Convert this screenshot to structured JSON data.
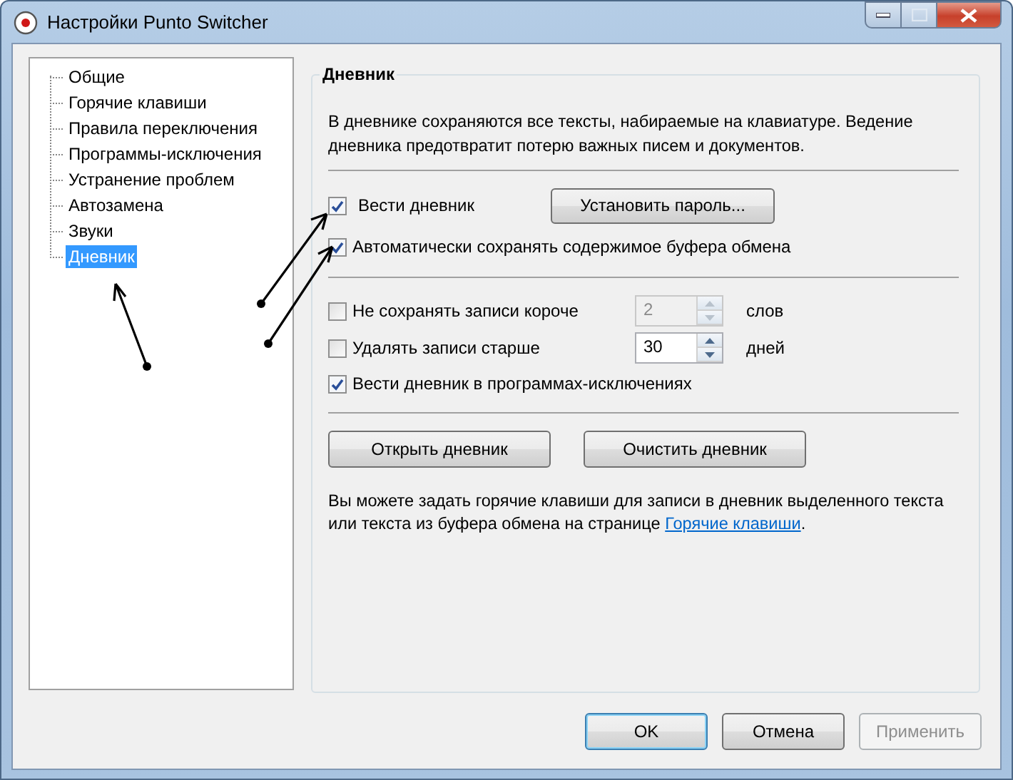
{
  "window": {
    "title": "Настройки Punto Switcher"
  },
  "sidebar": {
    "items": [
      {
        "label": "Общие",
        "selected": false
      },
      {
        "label": "Горячие клавиши",
        "selected": false
      },
      {
        "label": "Правила переключения",
        "selected": false
      },
      {
        "label": "Программы-исключения",
        "selected": false
      },
      {
        "label": "Устранение проблем",
        "selected": false
      },
      {
        "label": "Автозамена",
        "selected": false
      },
      {
        "label": "Звуки",
        "selected": false
      },
      {
        "label": "Дневник",
        "selected": true
      }
    ]
  },
  "group": {
    "title": "Дневник",
    "description": "В дневнике сохраняются все тексты, набираемые на клавиатуре. Ведение дневника предотвратит потерю важных писем и документов.",
    "sections": [
      [
        {
          "kind": "checkbox",
          "label": "Вести дневник",
          "checked": true,
          "button": "Установить пароль..."
        },
        {
          "kind": "checkbox",
          "label": "Автоматически сохранять содержимое буфера обмена",
          "checked": true
        }
      ],
      [
        {
          "kind": "spin",
          "label": "Не сохранять записи короче",
          "checked": false,
          "value": "2",
          "unit": "слов",
          "disabled": true
        },
        {
          "kind": "spin",
          "label": "Удалять записи старше",
          "checked": false,
          "value": "30",
          "unit": "дней",
          "disabled": false
        },
        {
          "kind": "checkbox",
          "label": "Вести дневник в программах-исключениях",
          "checked": true
        }
      ]
    ],
    "buttons": [
      "Открыть дневник",
      "Очистить дневник"
    ],
    "note": {
      "text": "Вы можете задать горячие клавиши для записи в дневник выделенного текста или текста из буфера обмена на странице",
      "link": "Горячие клавиши",
      "end": "."
    }
  },
  "footer": {
    "buttons": [
      {
        "label": "OK",
        "default": true,
        "disabled": false
      },
      {
        "label": "Отмена",
        "default": false,
        "disabled": false
      },
      {
        "label": "Применить",
        "default": false,
        "disabled": true
      }
    ]
  }
}
